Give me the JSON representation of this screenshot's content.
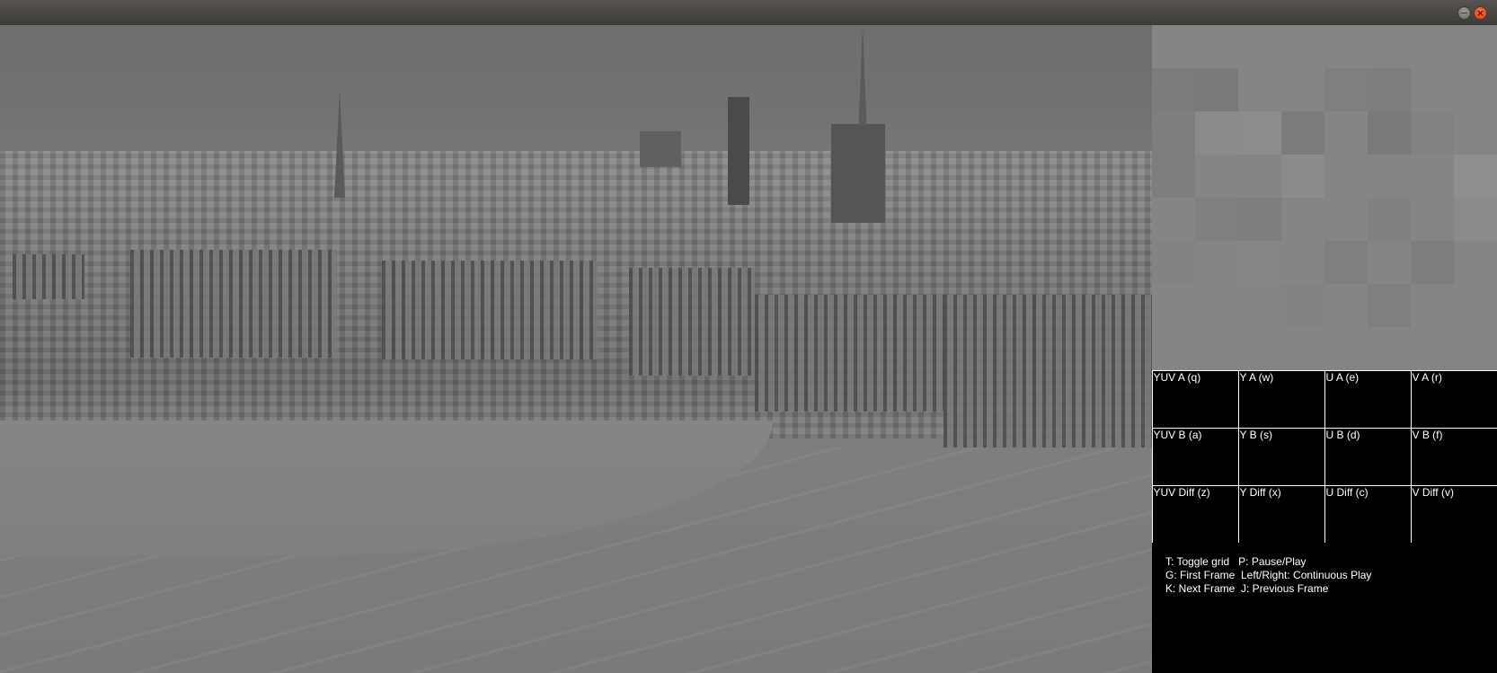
{
  "window": {
    "controls": [
      {
        "name": "minimize",
        "glyph": "−"
      },
      {
        "name": "close",
        "glyph": "×"
      }
    ]
  },
  "grid": {
    "cells": [
      {
        "label": "YUV A (q)"
      },
      {
        "label": "Y A (w)"
      },
      {
        "label": "U A (e)"
      },
      {
        "label": "V A (r)"
      },
      {
        "label": "YUV B (a)"
      },
      {
        "label": "Y B (s)"
      },
      {
        "label": "U B (d)"
      },
      {
        "label": "V B (f)"
      },
      {
        "label": "YUV Diff (z)"
      },
      {
        "label": "Y Diff (x)"
      },
      {
        "label": "U Diff (c)"
      },
      {
        "label": "V Diff (v)"
      }
    ]
  },
  "help": {
    "lines": [
      "T: Toggle grid   P: Pause/Play",
      "G: First Frame  Left/Right: Continuous Play",
      "K: Next Frame  J: Previous Frame"
    ]
  },
  "colors": {
    "grid_border": "#ffffff",
    "panel_background": "#000000",
    "frame_tone": "#7d7d7d"
  }
}
